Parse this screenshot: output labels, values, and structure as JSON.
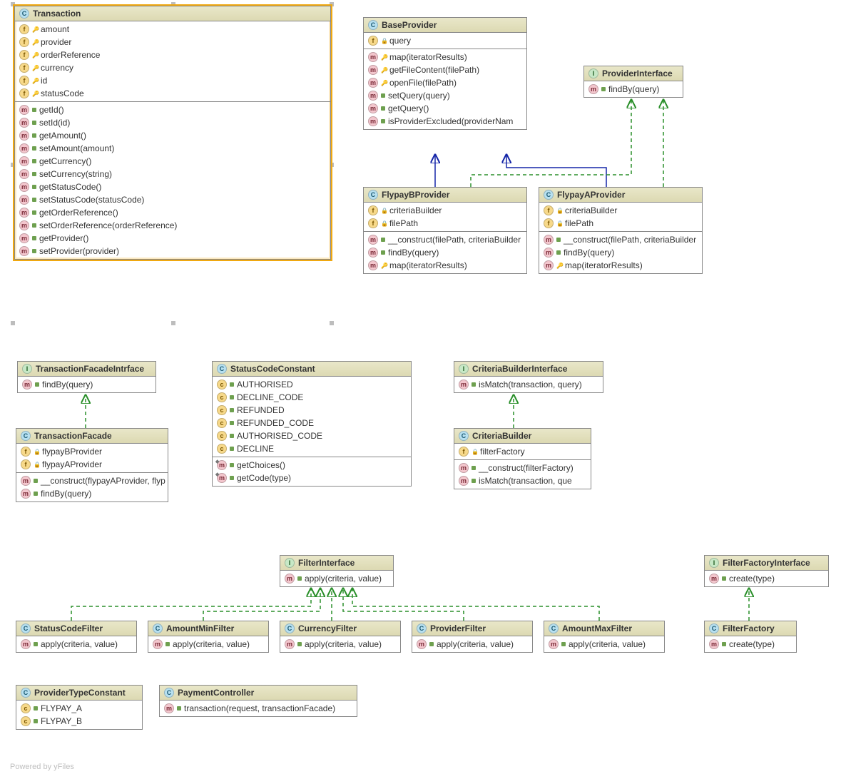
{
  "footer": "Powered by yFiles",
  "classes": {
    "transaction": {
      "kind": "C",
      "name": "Transaction",
      "fields": [
        {
          "vis": "key",
          "label": "amount"
        },
        {
          "vis": "key",
          "label": "provider"
        },
        {
          "vis": "key",
          "label": "orderReference"
        },
        {
          "vis": "key",
          "label": "currency"
        },
        {
          "vis": "key",
          "label": "id"
        },
        {
          "vis": "key",
          "label": "statusCode"
        }
      ],
      "methods": [
        {
          "label": "getId()"
        },
        {
          "label": "setId(id)"
        },
        {
          "label": "getAmount()"
        },
        {
          "label": "setAmount(amount)"
        },
        {
          "label": "getCurrency()"
        },
        {
          "label": "setCurrency(string)"
        },
        {
          "label": "getStatusCode()"
        },
        {
          "label": "setStatusCode(statusCode)"
        },
        {
          "label": "getOrderReference()"
        },
        {
          "label": "setOrderReference(orderReference)"
        },
        {
          "label": "getProvider()"
        },
        {
          "label": "setProvider(provider)"
        }
      ]
    },
    "baseProvider": {
      "kind": "C",
      "name": "BaseProvider",
      "fields": [
        {
          "vis": "lock",
          "label": "query"
        }
      ],
      "methods": [
        {
          "label": "map(iteratorResults)"
        },
        {
          "label": "getFileContent(filePath)"
        },
        {
          "label": "openFile(filePath)"
        },
        {
          "label": "setQuery(query)"
        },
        {
          "label": "getQuery()"
        },
        {
          "label": "isProviderExcluded(providerNam"
        }
      ]
    },
    "providerInterface": {
      "kind": "I",
      "name": "ProviderInterface",
      "methods": [
        {
          "label": "findBy(query)"
        }
      ]
    },
    "flypayBProvider": {
      "kind": "C",
      "name": "FlypayBProvider",
      "fields": [
        {
          "vis": "lock",
          "label": "criteriaBuilder"
        },
        {
          "vis": "lock",
          "label": "filePath"
        }
      ],
      "methods": [
        {
          "label": "__construct(filePath, criteriaBuilder"
        },
        {
          "label": "findBy(query)"
        },
        {
          "label": "map(iteratorResults)",
          "vis": "key"
        }
      ]
    },
    "flypayAProvider": {
      "kind": "C",
      "name": "FlypayAProvider",
      "fields": [
        {
          "vis": "lock",
          "label": "criteriaBuilder"
        },
        {
          "vis": "lock",
          "label": "filePath"
        }
      ],
      "methods": [
        {
          "label": "__construct(filePath, criteriaBuilder"
        },
        {
          "label": "findBy(query)"
        },
        {
          "label": "map(iteratorResults)",
          "vis": "key"
        }
      ]
    },
    "transactionFacadeInterface": {
      "kind": "I",
      "name": "TransactionFacadeIntrface",
      "methods": [
        {
          "label": "findBy(query)"
        }
      ]
    },
    "transactionFacade": {
      "kind": "C",
      "name": "TransactionFacade",
      "fields": [
        {
          "vis": "lock",
          "label": "flypayBProvider"
        },
        {
          "vis": "lock",
          "label": "flypayAProvider"
        }
      ],
      "methods": [
        {
          "label": "__construct(flypayAProvider, flyp"
        },
        {
          "label": "findBy(query)"
        }
      ]
    },
    "statusCodeConstant": {
      "kind": "C",
      "name": "StatusCodeConstant",
      "constants": [
        "AUTHORISED",
        "DECLINE_CODE",
        "REFUNDED",
        "REFUNDED_CODE",
        "AUTHORISED_CODE",
        "DECLINE"
      ],
      "staticMethods": [
        "getChoices()",
        "getCode(type)"
      ]
    },
    "criteriaBuilderInterface": {
      "kind": "I",
      "name": "CriteriaBuilderInterface",
      "methods": [
        {
          "label": "isMatch(transaction, query)"
        }
      ]
    },
    "criteriaBuilder": {
      "kind": "C",
      "name": "CriteriaBuilder",
      "fields": [
        {
          "vis": "lock",
          "label": "filterFactory"
        }
      ],
      "methods": [
        {
          "label": "__construct(filterFactory)"
        },
        {
          "label": "isMatch(transaction, que"
        }
      ]
    },
    "filterInterface": {
      "kind": "I",
      "name": "FilterInterface",
      "methods": [
        {
          "label": "apply(criteria, value)"
        }
      ]
    },
    "statusCodeFilter": {
      "kind": "C",
      "name": "StatusCodeFilter",
      "methods": [
        {
          "label": "apply(criteria, value)"
        }
      ]
    },
    "amountMinFilter": {
      "kind": "C",
      "name": "AmountMinFilter",
      "methods": [
        {
          "label": "apply(criteria, value)"
        }
      ]
    },
    "currencyFilter": {
      "kind": "C",
      "name": "CurrencyFilter",
      "methods": [
        {
          "label": "apply(criteria, value)"
        }
      ]
    },
    "providerFilter": {
      "kind": "C",
      "name": "ProviderFilter",
      "methods": [
        {
          "label": "apply(criteria, value)"
        }
      ]
    },
    "amountMaxFilter": {
      "kind": "C",
      "name": "AmountMaxFilter",
      "methods": [
        {
          "label": "apply(criteria, value)"
        }
      ]
    },
    "filterFactoryInterface": {
      "kind": "I",
      "name": "FilterFactoryInterface",
      "methods": [
        {
          "label": "create(type)"
        }
      ]
    },
    "filterFactory": {
      "kind": "C",
      "name": "FilterFactory",
      "methods": [
        {
          "label": "create(type)"
        }
      ]
    },
    "providerTypeConstant": {
      "kind": "C",
      "name": "ProviderTypeConstant",
      "constants": [
        "FLYPAY_A",
        "FLYPAY_B"
      ]
    },
    "paymentController": {
      "kind": "C",
      "name": "PaymentController",
      "methods": [
        {
          "label": "transaction(request, transactionFacade)"
        }
      ]
    }
  }
}
